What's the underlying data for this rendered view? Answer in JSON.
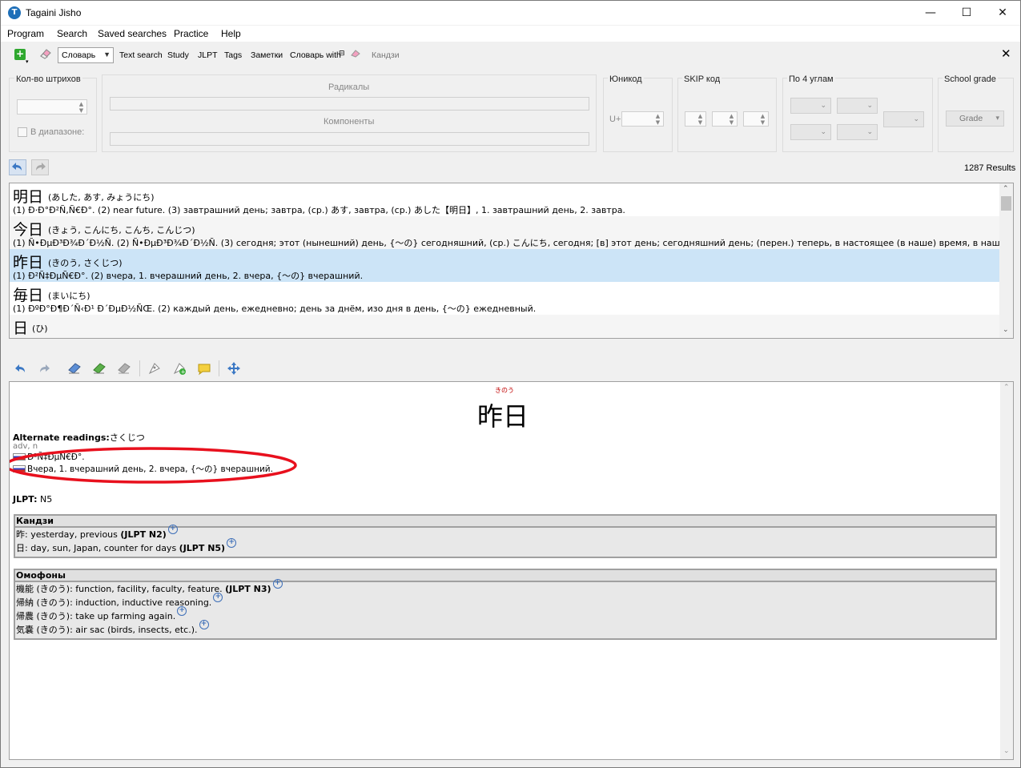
{
  "window": {
    "title": "Tagaini Jisho",
    "controls": {
      "minimize": "—",
      "maximize": "☐",
      "close": "✕"
    }
  },
  "menu": [
    "Program",
    "Search",
    "Saved searches",
    "Practice",
    "Help"
  ],
  "toolbar": {
    "dictionary_select": "Словарь",
    "items": [
      "Text search",
      "Study",
      "JLPT",
      "Tags",
      "Заметки",
      "Словарь with"
    ],
    "kanji_label": "Кандзи"
  },
  "filters": {
    "strokes": {
      "label": "Кол-во штрихов",
      "range_label": "В диапазоне:"
    },
    "radicals_label": "Радикалы",
    "components_label": "Компоненты",
    "unicode": {
      "label": "Юникод",
      "prefix": "U+"
    },
    "skip": {
      "label": "SKIP код"
    },
    "four_corner": {
      "label": "По 4 углам"
    },
    "school_grade": {
      "label": "School grade",
      "button": "Grade"
    }
  },
  "results_count": "1287 Results",
  "results": [
    {
      "kanji": "明日",
      "kana": "(あした, あす, みょうにち)",
      "gloss": "(1) Ð·Ð°Ð²Ñ‚Ñ€Ð°. (2) near future. (3) завтрашний день; завтра, (ср.) あす, завтра, (ср.) あした【明日】, 1. завтрашний день, 2. завтра."
    },
    {
      "kanji": "今日",
      "kana": "(きょう, こんにち, こんち, こんじつ)",
      "gloss": "(1) Ñ•ÐµÐ³Ð¾Ð´Ð½Ñ. (2) Ñ•ÐµÐ³Ð¾Ð´Ð½Ñ. (3) сегодня; этот (нынешний) день, {～の} сегодняшний, (ср.) こんにち, сегодня; [в] этот день; сегодняшний день; (перен.) теперь, в настоящее (в наше) время, в наши дни."
    },
    {
      "kanji": "昨日",
      "kana": "(きのう, さくじつ)",
      "gloss": "(1) Ð²Ñ‡ÐµÑ€Ð°. (2) вчера, 1. вчерашний день, 2. вчера, {～の} вчерашний."
    },
    {
      "kanji": "毎日",
      "kana": "(まいにち)",
      "gloss": "(1) ÐºÐ°Ð¶Ð´Ñ‹Ð¹ Ð´ÐµÐ½ÑŒ. (2) каждый день, ежедневно; день за днём, изо дня в день, {～の} ежедневный."
    },
    {
      "kanji": "日",
      "kana": "(ひ)",
      "gloss": ""
    }
  ],
  "detail": {
    "furigana": "きのう",
    "headword": "昨日",
    "alt_label": "Alternate readings:",
    "alt_value": "さくじつ",
    "pos": "adv, n",
    "sense1": "Ð²Ñ‡ÐµÑ€Ð°.",
    "sense2": "Вчера, 1. вчерашний день, 2. вчера, {～の} вчерашний.",
    "jlpt_label": "JLPT:",
    "jlpt_value": "N5",
    "kanji_header": "Кандзи",
    "kanji_rows": [
      {
        "char": "昨",
        "text": ": yesterday, previous ",
        "level": "(JLPT N2)"
      },
      {
        "char": "日",
        "text": ": day, sun, Japan, counter for days ",
        "level": "(JLPT N5)"
      }
    ],
    "homophones_header": "Омофоны",
    "homophones": [
      {
        "word": "機能",
        "reading": " (きのう)",
        "text": ": function, facility, faculty, feature. ",
        "level": "(JLPT N3)"
      },
      {
        "word": "帰納",
        "reading": " (きのう)",
        "text": ": induction, inductive reasoning.",
        "level": ""
      },
      {
        "word": "帰農",
        "reading": " (きのう)",
        "text": ": take up farming again.",
        "level": ""
      },
      {
        "word": "気嚢",
        "reading": " (きのう)",
        "text": ": air sac (birds, insects, etc.).",
        "level": ""
      }
    ]
  },
  "colors": {
    "highlight_row": "#cce4f7",
    "annotation": "#e8101d",
    "furigana": "#c00000"
  }
}
